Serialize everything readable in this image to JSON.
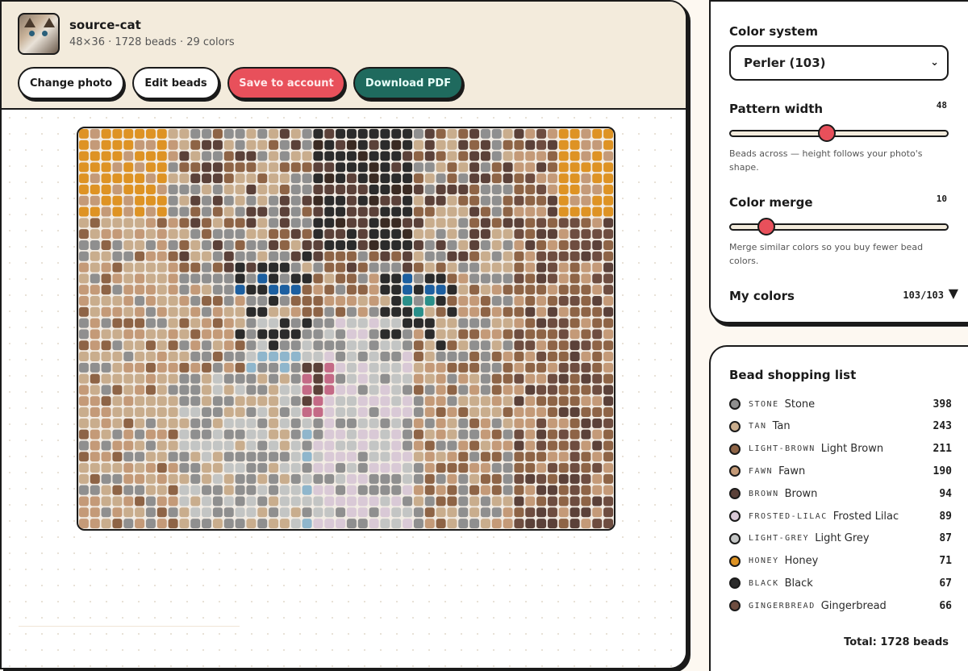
{
  "photo": {
    "title": "source-cat",
    "meta": "48×36 · 1728 beads · 29 colors"
  },
  "toolbar": {
    "change_photo": "Change photo",
    "edit_beads": "Edit beads",
    "save_account": "Save to account",
    "download_pdf": "Download PDF"
  },
  "board": {
    "columns": 48,
    "rows": 36
  },
  "settings": {
    "color_system_label": "Color system",
    "color_system_value": "Perler (103)",
    "pattern_width_label": "Pattern width",
    "pattern_width_value": "48",
    "pattern_width_fraction": 0.44,
    "pattern_width_help": "Beads across — height follows your photo's shape.",
    "color_merge_label": "Color merge",
    "color_merge_value": "10",
    "color_merge_fraction": 0.14,
    "color_merge_help": "Merge similar colors so you buy fewer bead colors.",
    "my_colors_label": "My colors",
    "my_colors_count": "103/103"
  },
  "shopping": {
    "title": "Bead shopping list",
    "items": [
      {
        "code": "STONE",
        "name": "Stone",
        "count": "398",
        "color": "#8f8f8f"
      },
      {
        "code": "TAN",
        "name": "Tan",
        "count": "243",
        "color": "#c9ad8d"
      },
      {
        "code": "LIGHT-BROWN",
        "name": "Light Brown",
        "count": "211",
        "color": "#8e6446"
      },
      {
        "code": "FAWN",
        "name": "Fawn",
        "count": "190",
        "color": "#c49a78"
      },
      {
        "code": "BROWN",
        "name": "Brown",
        "count": "94",
        "color": "#5b4139"
      },
      {
        "code": "FROSTED-LILAC",
        "name": "Frosted Lilac",
        "count": "89",
        "color": "#d9c9d6"
      },
      {
        "code": "LIGHT-GREY",
        "name": "Light Grey",
        "count": "87",
        "color": "#c3c5c4"
      },
      {
        "code": "HONEY",
        "name": "Honey",
        "count": "71",
        "color": "#de9324"
      },
      {
        "code": "BLACK",
        "name": "Black",
        "count": "67",
        "color": "#2b2b2b"
      },
      {
        "code": "GINGERBREAD",
        "name": "Gingerbread",
        "count": "66",
        "color": "#6e4d40"
      }
    ],
    "total": "Total: 1728 beads"
  },
  "colors": {
    "coral": "#e8505b",
    "teal": "#1f6a5e",
    "cream": "#f3ebdc"
  }
}
